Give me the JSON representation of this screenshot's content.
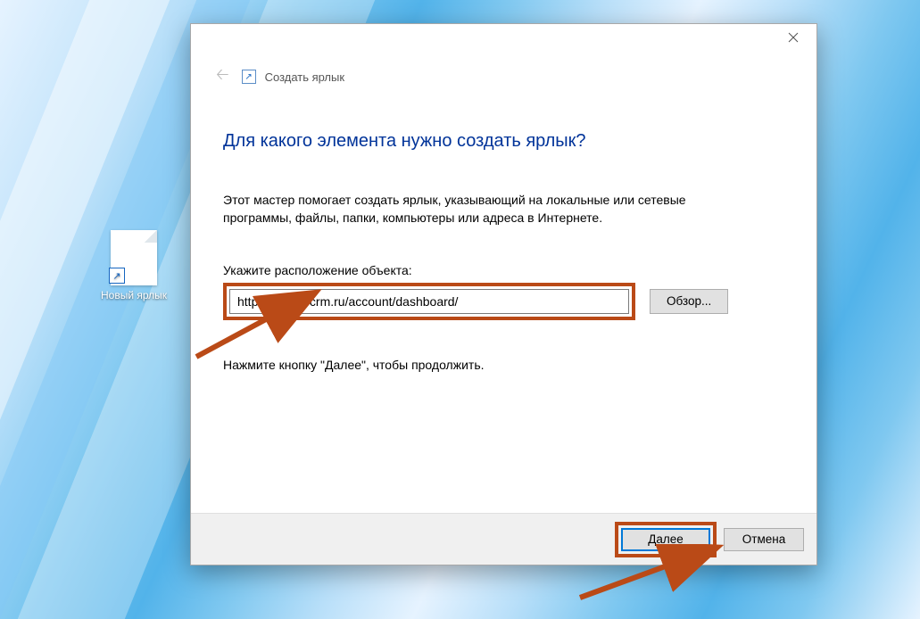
{
  "desktop": {
    "icon_label": "Новый ярлык"
  },
  "dialog": {
    "header_title": "Создать ярлык",
    "heading": "Для какого элемента нужно создать ярлык?",
    "description": "Этот мастер помогает создать ярлык, указывающий на локальные или сетевые программы, файлы, папки, компьютеры или адреса в Интернете.",
    "field_label": "Укажите расположение объекта:",
    "location_value": "https://macrocrm.ru/account/dashboard/",
    "browse_label": "Обзор...",
    "continue_hint": "Нажмите кнопку \"Далее\", чтобы продолжить.",
    "next_label": "Далее",
    "cancel_label": "Отмена"
  },
  "annotation_color": "#ba4a17"
}
